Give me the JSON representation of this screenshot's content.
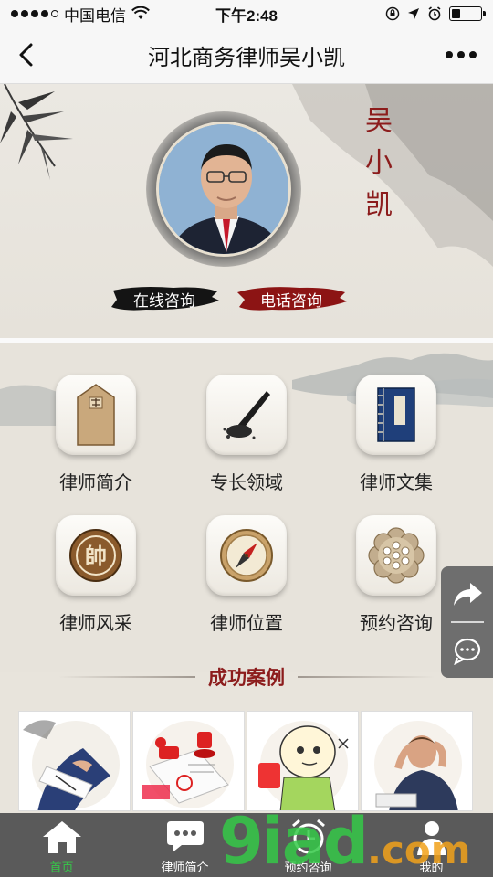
{
  "status_bar": {
    "carrier": "中国电信",
    "time": "下午2:48",
    "signal_dots": 4,
    "battery_level": 0.3
  },
  "navbar": {
    "title": "河北商务律师吴小凯"
  },
  "hero": {
    "name_chars": [
      "吴",
      "小",
      "凯"
    ],
    "online_button": "在线咨询",
    "phone_button": "电话咨询"
  },
  "grid": [
    {
      "label": "律师简介",
      "icon": "tablet-icon"
    },
    {
      "label": "专长领域",
      "icon": "brush-icon"
    },
    {
      "label": "律师文集",
      "icon": "book-icon"
    },
    {
      "label": "律师风采",
      "icon": "chess-shuai-icon"
    },
    {
      "label": "律师位置",
      "icon": "compass-icon"
    },
    {
      "label": "预约咨询",
      "icon": "lotus-icon"
    }
  ],
  "cases": {
    "title": "成功案例"
  },
  "tabbar": [
    {
      "label": "首页",
      "icon": "home-icon"
    },
    {
      "label": "律师简介",
      "icon": "chat-icon"
    },
    {
      "label": "预约咨询",
      "icon": "alarm-icon"
    },
    {
      "label": "我的",
      "icon": "person-icon"
    }
  ],
  "watermark": {
    "main": "9iad",
    "suffix": ".com"
  },
  "colors": {
    "accent_red": "#8c1c1c",
    "tabbar_bg": "#5a5a5a",
    "watermark_green": "#35c948",
    "watermark_orange": "#f2a21b"
  }
}
